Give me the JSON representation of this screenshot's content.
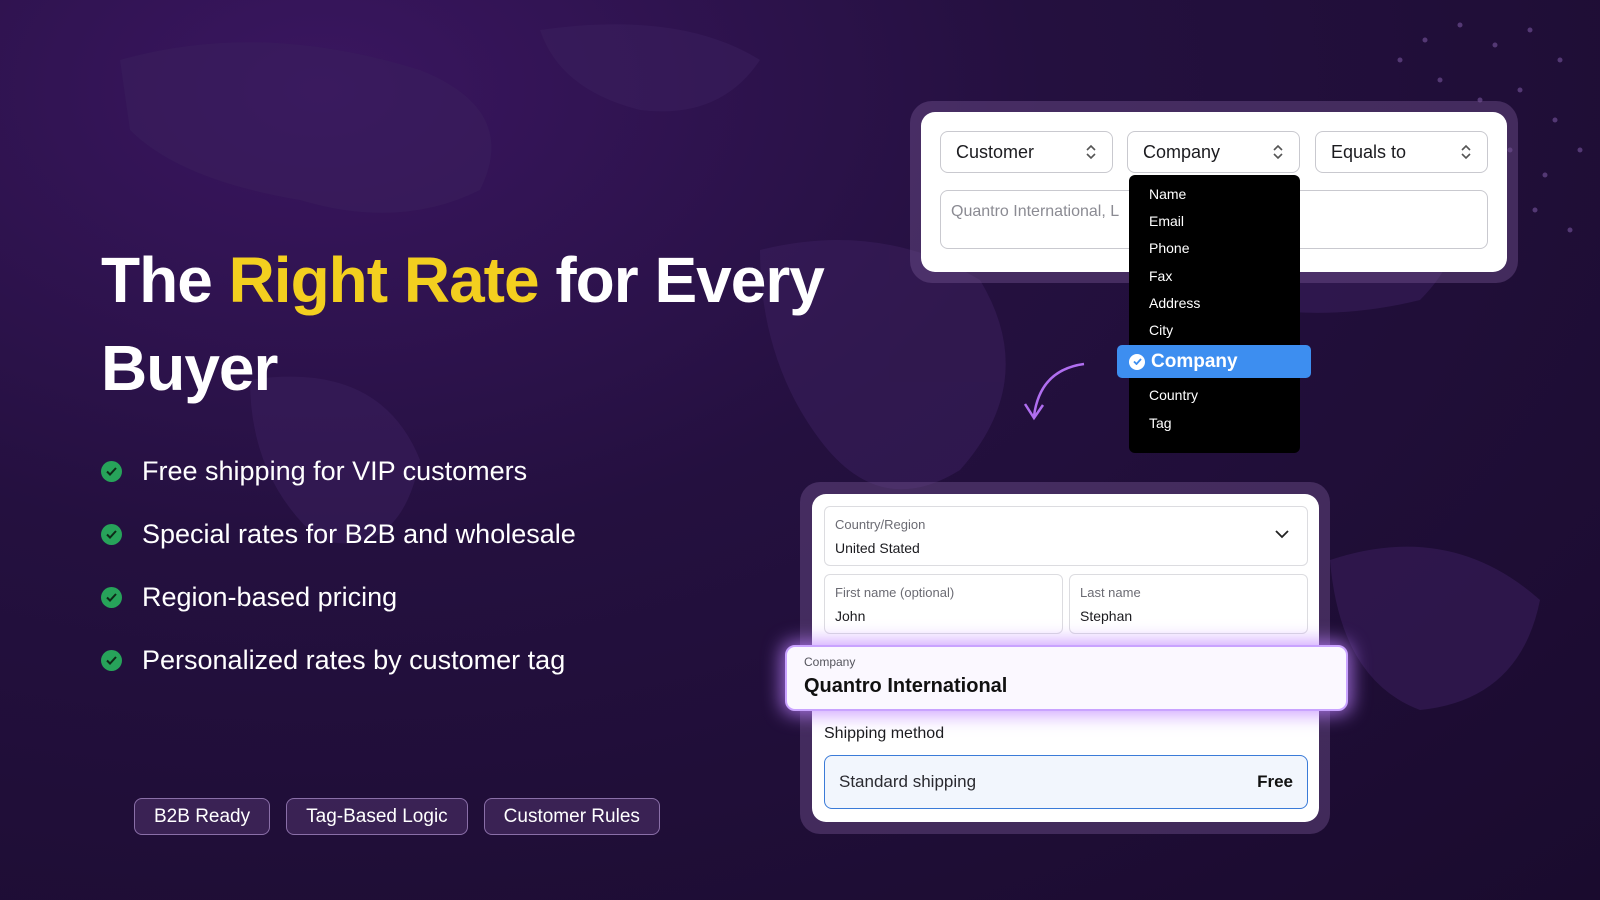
{
  "headline": {
    "part1": "The ",
    "highlight": "Right Rate",
    "part2": " for Every Buyer"
  },
  "features": [
    "Free shipping for VIP customers",
    "Special rates for B2B and wholesale",
    "Region-based pricing",
    "Personalized rates by customer tag"
  ],
  "tags": [
    "B2B Ready",
    "Tag-Based Logic",
    "Customer Rules"
  ],
  "rule_builder": {
    "field_select": "Customer",
    "attribute_select": "Company",
    "operator_select": "Equals to",
    "value_input": "Quantro International, L",
    "dropdown_options": [
      "Name",
      "Email",
      "Phone",
      "Fax",
      "Address",
      "City",
      "Company",
      "Country",
      "Tag"
    ],
    "dropdown_selected": "Company"
  },
  "checkout_form": {
    "country_label": "Country/Region",
    "country_value": "United Stated",
    "first_name_label": "First name (optional)",
    "first_name_value": "John",
    "last_name_label": "Last name",
    "last_name_value": "Stephan",
    "company_label": "Company",
    "company_value": "Quantro International",
    "shipping_label": "Shipping method",
    "shipping_option": "Standard shipping",
    "shipping_price": "Free"
  },
  "colors": {
    "highlight": "#f3cf1f",
    "check": "#27a35a",
    "selected": "#3d8ef0",
    "glow": "#c9a3ff"
  }
}
